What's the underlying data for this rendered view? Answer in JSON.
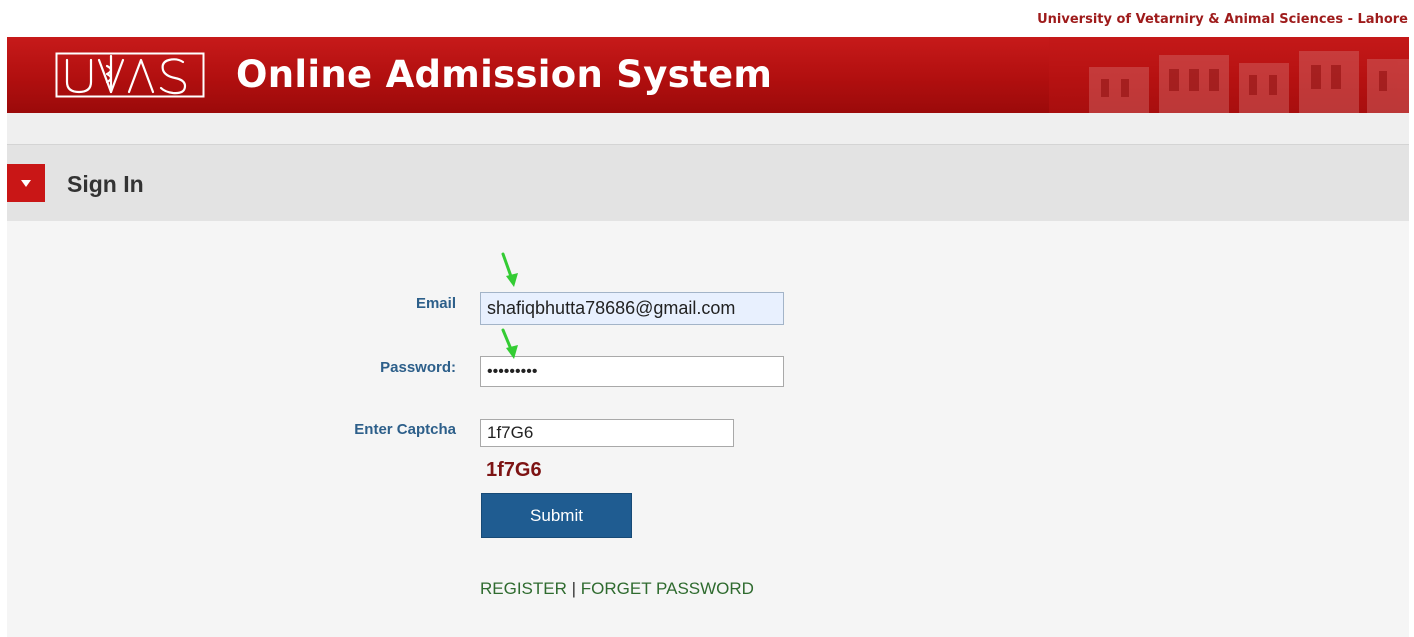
{
  "header": {
    "university_name": "University of Vetarniry & Animal Sciences - Lahore",
    "logo_text": "UVAS",
    "title": "Online Admission System"
  },
  "section": {
    "title": "Sign In",
    "toggle_icon": "triangle-down-icon"
  },
  "form": {
    "email_label": "Email",
    "email_value": "shafiqbhutta78686@gmail.com",
    "password_label": "Password:",
    "password_value": "123456789",
    "captcha_label": "Enter Captcha",
    "captcha_input_value": "1f7G6",
    "captcha_text": "1f7G6",
    "submit_label": "Submit"
  },
  "links": {
    "register": "REGISTER",
    "separator": "|",
    "forget_password": "FORGET PASSWORD"
  },
  "colors": {
    "banner": "#b51212",
    "label": "#2d5f8a",
    "captcha": "#7d1313",
    "submit": "#1f5c91",
    "link": "#2f6b2f",
    "annotation_arrow": "#33cc33"
  }
}
